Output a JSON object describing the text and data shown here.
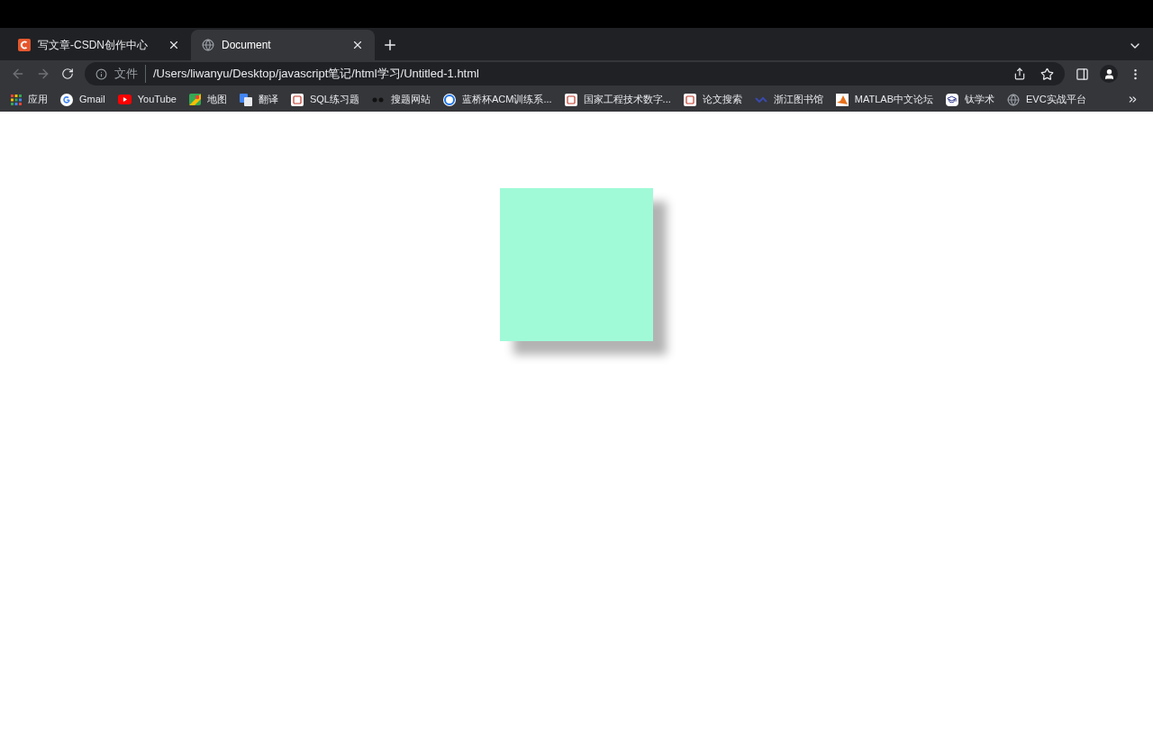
{
  "tabs": [
    {
      "title": "写文章-CSDN创作中心",
      "kind": "csdn",
      "selected": false
    },
    {
      "title": "Document",
      "kind": "globe",
      "selected": true
    }
  ],
  "address_bar": {
    "scheme_label": "文件",
    "url": "/Users/liwanyu/Desktop/javascript笔记/html学习/Untitled-1.html"
  },
  "bookmarks": [
    {
      "label": "应用",
      "kind": "grid"
    },
    {
      "label": "Gmail",
      "kind": "google"
    },
    {
      "label": "YouTube",
      "kind": "youtube"
    },
    {
      "label": "地图",
      "kind": "maps"
    },
    {
      "label": "翻译",
      "kind": "translate"
    },
    {
      "label": "SQL练习题",
      "kind": "square"
    },
    {
      "label": "搜题网站",
      "kind": "dots"
    },
    {
      "label": "蓝桥杯ACM训练系...",
      "kind": "circle"
    },
    {
      "label": "国家工程技术数字...",
      "kind": "square"
    },
    {
      "label": "论文搜索",
      "kind": "square"
    },
    {
      "label": "浙江图书馆",
      "kind": "wave"
    },
    {
      "label": "MATLAB中文论坛",
      "kind": "matlab"
    },
    {
      "label": "钛学术",
      "kind": "cap"
    },
    {
      "label": "EVC实战平台",
      "kind": "globe"
    }
  ]
}
